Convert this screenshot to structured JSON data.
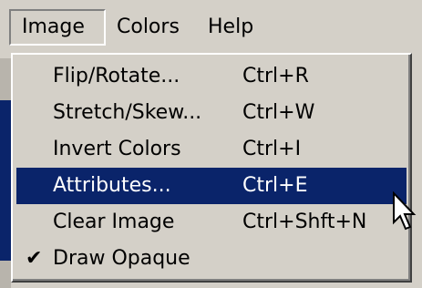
{
  "menubar": {
    "items": [
      {
        "label": "Image",
        "active": true
      },
      {
        "label": "Colors",
        "active": false
      },
      {
        "label": "Help",
        "active": false
      }
    ]
  },
  "menu": {
    "items": [
      {
        "label": "Flip/Rotate...",
        "shortcut": "Ctrl+R"
      },
      {
        "label": "Stretch/Skew...",
        "shortcut": "Ctrl+W"
      },
      {
        "label": "Invert Colors",
        "shortcut": "Ctrl+I"
      },
      {
        "label": "Attributes...",
        "shortcut": "Ctrl+E",
        "selected": true
      },
      {
        "label": "Clear Image",
        "shortcut": "Ctrl+Shft+N"
      },
      {
        "label": "Draw Opaque",
        "checked": true,
        "check_glyph": "✔"
      }
    ]
  },
  "colors": {
    "menu_bg": "#d4d0c8",
    "highlight": "#0a246a",
    "highlight_text": "#ffffff"
  },
  "icons": {
    "check": "checkmark-icon",
    "cursor": "mouse-pointer-icon"
  }
}
